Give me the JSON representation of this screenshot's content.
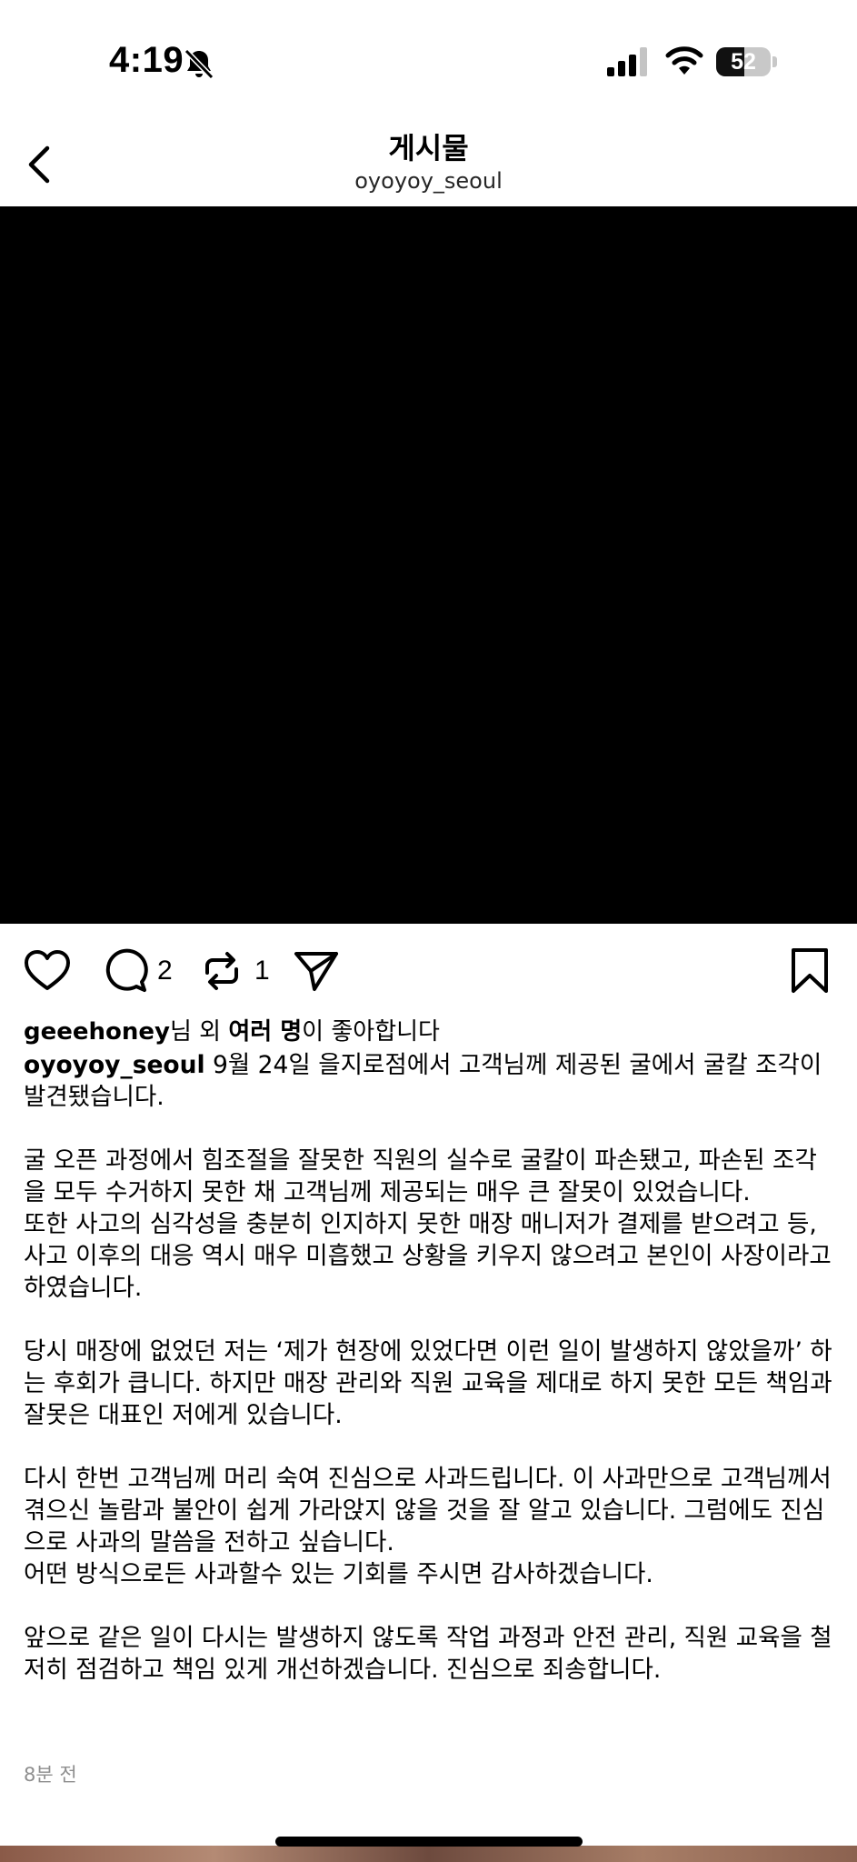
{
  "status_bar": {
    "time": "4:19",
    "battery_level": "52",
    "icons": [
      "bell-slash-icon",
      "cellular-signal-icon",
      "wifi-icon",
      "battery-icon"
    ]
  },
  "header": {
    "title": "게시물",
    "subtitle": "oyoyoy_seoul",
    "back_icon": "chevron-left-icon"
  },
  "actions": {
    "icons": [
      "heart-icon",
      "comment-icon",
      "repost-icon",
      "send-icon",
      "bookmark-icon"
    ],
    "comment_count": "2",
    "repost_count": "1"
  },
  "likes": {
    "user": "geeehoney",
    "middle": "님 외 ",
    "others": "여러 명",
    "suffix": "이 좋아합니다"
  },
  "caption": {
    "username": "oyoyoy_seoul",
    "lead": " 9월 24일 을지로점에서 고객님께 제공된 굴에서 굴칼 조각이 발견됐습니다.",
    "p2_line1": "굴 오픈 과정에서 힘조절을 잘못한 직원의 실수로 굴칼이 파손됐고, 파손된 조각을 모두 수거하지 못한 채 고객님께 제공되는 매우 큰 잘못이 있었습니다.",
    "p2_line2": "또한 사고의 심각성을 충분히 인지하지 못한 매장 매니저가 결제를 받으려고 등, 사고 이후의 대응 역시 매우 미흡했고 상황을 키우지 않으려고 본인이 사장이라고 하였습니다.",
    "p3": "당시 매장에 없었던 저는 ‘제가 현장에 있었다면 이런 일이 발생하지 않았을까’ 하는 후회가 큽니다. 하지만 매장 관리와 직원 교육을 제대로 하지 못한 모든 책임과 잘못은 대표인 저에게 있습니다.",
    "p4_line1": "다시 한번 고객님께 머리 숙여 진심으로 사과드립니다. 이 사과만으로 고객님께서 겪으신 놀람과 불안이 쉽게 가라앉지 않을 것을 잘 알고 있습니다. 그럼에도 진심으로 사과의 말씀을 전하고 싶습니다.",
    "p4_line2": "어떤 방식으로든 사과할수 있는 기회를 주시면 감사하겠습니다.",
    "p5": "앞으로 같은 일이 다시는 발생하지 않도록 작업 과정과 안전 관리, 직원 교육을 철저히 점검하고 책임 있게 개선하겠습니다. 진심으로 죄송합니다."
  },
  "timestamp": "8분 전"
}
